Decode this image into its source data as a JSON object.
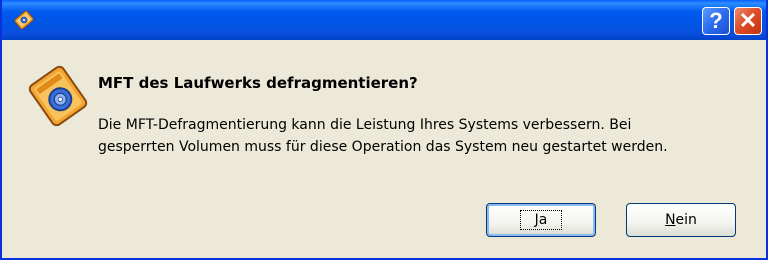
{
  "dialog": {
    "title_icon": "defrag-icon",
    "help_button_label": "?",
    "close_button_label": "✕",
    "content_icon": "disk-defrag-icon",
    "heading": "MFT des Laufwerks defragmentieren?",
    "message_line1": "Die MFT-Defragmentierung kann die Leistung Ihres Systems verbessern. Bei",
    "message_line2": "gesperrten Volumen muss für diese Operation das System neu gestartet werden.",
    "yes_accel": "J",
    "yes_rest": "a",
    "no_accel": "N",
    "no_rest": "ein"
  },
  "colors": {
    "titlebar": "#0054e3",
    "window_bg": "#ece9d8",
    "close_button": "#dc4a26",
    "help_button": "#2c6bef",
    "icon_orange": "#f2a531",
    "icon_blue": "#3a6fd8"
  }
}
